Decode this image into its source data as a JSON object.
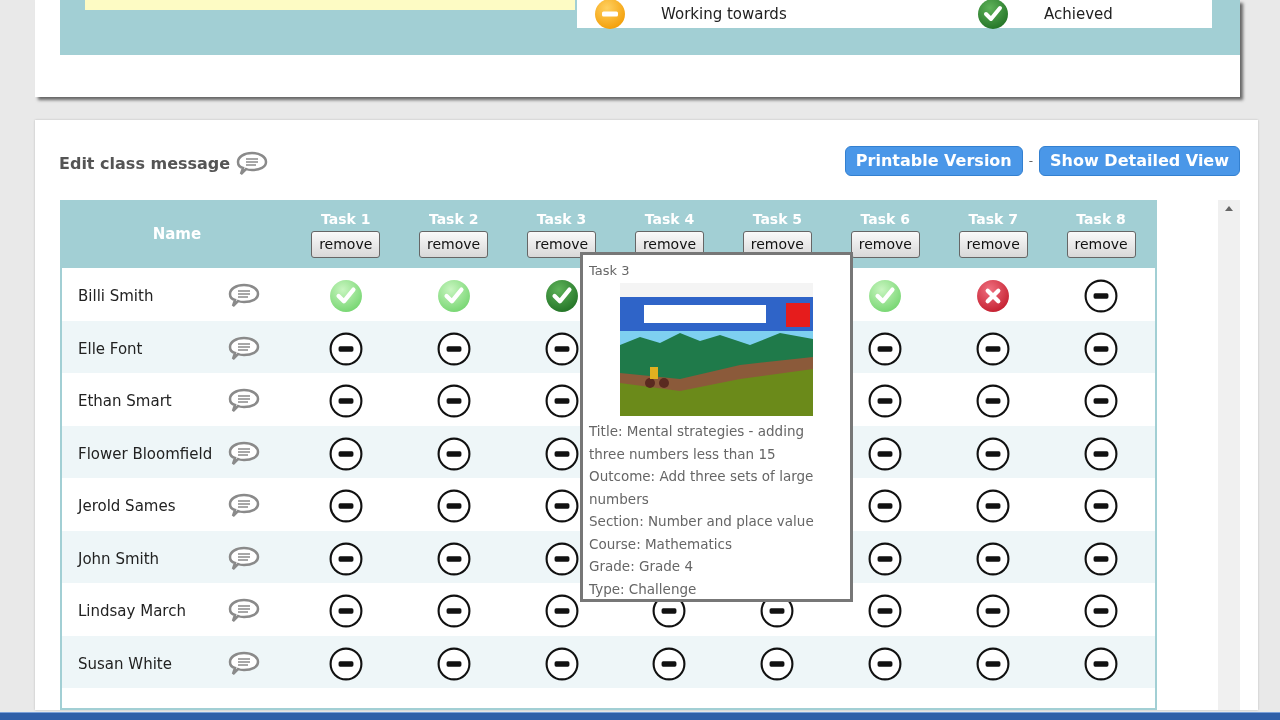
{
  "legend": [
    {
      "kind": "working",
      "label": "Working towards"
    },
    {
      "kind": "achieved",
      "label": "Achieved"
    }
  ],
  "class_message": {
    "label": "Edit class message"
  },
  "actions": [
    {
      "label": "Printable Version"
    },
    {
      "label": "Show Detailed View"
    }
  ],
  "actions_separator": "-",
  "table": {
    "name_header": "Name",
    "columns": [
      {
        "label": "Task 1",
        "button": "remove"
      },
      {
        "label": "Task 2",
        "button": "remove"
      },
      {
        "label": "Task 3",
        "button": "remove"
      },
      {
        "label": "Task 4",
        "button": "remove"
      },
      {
        "label": "Task 5",
        "button": "remove"
      },
      {
        "label": "Task 6",
        "button": "remove"
      },
      {
        "label": "Task 7",
        "button": "remove"
      },
      {
        "label": "Task 8",
        "button": "remove"
      }
    ],
    "rows": [
      {
        "name": "Billi Smith",
        "cells": [
          {
            "kind": "passed"
          },
          {
            "kind": "passed"
          },
          {
            "kind": "achieved"
          },
          null,
          null,
          {
            "kind": "passed"
          },
          {
            "kind": "failed"
          },
          {
            "kind": "none"
          }
        ]
      },
      {
        "name": "Elle Font",
        "cells": [
          {
            "kind": "none"
          },
          {
            "kind": "none"
          },
          {
            "kind": "none"
          },
          null,
          null,
          {
            "kind": "none"
          },
          {
            "kind": "none"
          },
          {
            "kind": "none"
          }
        ]
      },
      {
        "name": "Ethan Smart",
        "cells": [
          {
            "kind": "none"
          },
          {
            "kind": "none"
          },
          {
            "kind": "none"
          },
          null,
          null,
          {
            "kind": "none"
          },
          {
            "kind": "none"
          },
          {
            "kind": "none"
          }
        ]
      },
      {
        "name": "Flower Bloomfield",
        "cells": [
          {
            "kind": "none"
          },
          {
            "kind": "none"
          },
          {
            "kind": "none"
          },
          null,
          null,
          {
            "kind": "none"
          },
          {
            "kind": "none"
          },
          {
            "kind": "none"
          }
        ]
      },
      {
        "name": "Jerold Sames",
        "cells": [
          {
            "kind": "none"
          },
          {
            "kind": "none"
          },
          {
            "kind": "none"
          },
          null,
          null,
          {
            "kind": "none"
          },
          {
            "kind": "none"
          },
          {
            "kind": "none"
          }
        ]
      },
      {
        "name": "John Smith",
        "cells": [
          {
            "kind": "none"
          },
          {
            "kind": "none"
          },
          {
            "kind": "none"
          },
          null,
          null,
          {
            "kind": "none"
          },
          {
            "kind": "none"
          },
          {
            "kind": "none"
          }
        ]
      },
      {
        "name": "Lindsay March",
        "cells": [
          {
            "kind": "none"
          },
          {
            "kind": "none"
          },
          {
            "kind": "none"
          },
          {
            "kind": "none"
          },
          {
            "kind": "none"
          },
          {
            "kind": "none"
          },
          {
            "kind": "none"
          },
          {
            "kind": "none"
          }
        ]
      },
      {
        "name": "Susan White",
        "cells": [
          {
            "kind": "none"
          },
          {
            "kind": "none"
          },
          {
            "kind": "none"
          },
          {
            "kind": "none"
          },
          {
            "kind": "none"
          },
          {
            "kind": "none"
          },
          {
            "kind": "none"
          },
          {
            "kind": "none"
          }
        ]
      }
    ]
  },
  "popup": {
    "title": "Task 3",
    "lines": [
      "Title: Mental strategies - adding three numbers less than 15",
      "Outcome: Add three sets of large numbers",
      "Section: Number and place value",
      "Course: Mathematics",
      "Grade: Grade 4",
      "Type: Challenge"
    ]
  }
}
